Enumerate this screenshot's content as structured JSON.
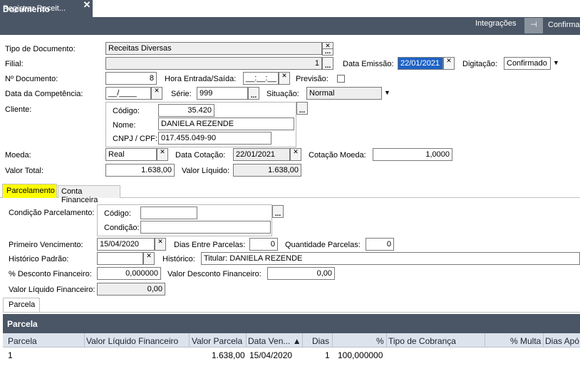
{
  "tab": {
    "title": "Registrar Receit...",
    "close": "✕"
  },
  "header": {
    "title": "Documento",
    "integracoes": "Integrações",
    "pin": "⊣",
    "confirmar": "Confirmar"
  },
  "form": {
    "tipo_documento": {
      "label": "Tipo de Documento:",
      "value": "Receitas Diversas"
    },
    "filial": {
      "label": "Filial:",
      "value": "1"
    },
    "data_emissao": {
      "label": "Data Emissão:",
      "value": "22/01/2021"
    },
    "digitacao": {
      "label": "Digitação:",
      "value": "Confirmado"
    },
    "num_documento": {
      "label": "Nº Documento:",
      "value": "8"
    },
    "hora_entrada": {
      "label": "Hora Entrada/Saída:",
      "value": "__:__:__"
    },
    "previsao": {
      "label": "Previsão:"
    },
    "data_competencia": {
      "label": "Data da Competência:",
      "value": "__/____"
    },
    "serie": {
      "label": "Série:",
      "value": "999"
    },
    "situacao": {
      "label": "Situação:",
      "value": "Normal"
    },
    "cliente": {
      "label": "Cliente:",
      "codigo_label": "Código:",
      "codigo": "35.420",
      "nome_label": "Nome:",
      "nome": "DANIELA REZENDE",
      "cnpj_label": "CNPJ / CPF:",
      "cnpj": "017.455.049-90"
    },
    "moeda": {
      "label": "Moeda:",
      "value": "Real"
    },
    "data_cotacao": {
      "label": "Data Cotação:",
      "value": "22/01/2021"
    },
    "cotacao_moeda": {
      "label": "Cotação Moeda:",
      "value": "1,0000"
    },
    "valor_total": {
      "label": "Valor Total:",
      "value": "1.638,00"
    },
    "valor_liquido": {
      "label": "Valor Líquido:",
      "value": "1.638,00"
    }
  },
  "tabs": {
    "parcelamento": "Parcelamento",
    "conta_financeira": "Conta Financeira"
  },
  "parcelamento": {
    "condicao": {
      "label": "Condição Parcelamento:",
      "codigo_label": "Código:",
      "codigo": "",
      "condicao_label": "Condição:",
      "condicao": ""
    },
    "primeiro_vencimento": {
      "label": "Primeiro Vencimento:",
      "value": "15/04/2020"
    },
    "dias_entre": {
      "label": "Dias Entre Parcelas:",
      "value": "0"
    },
    "qtd_parcelas": {
      "label": "Quantidade Parcelas:",
      "value": "0"
    },
    "historico_padrao": {
      "label": "Histórico Padrão:",
      "value": ""
    },
    "historico": {
      "label": "Histórico:",
      "value": "Titular: DANIELA REZENDE"
    },
    "desc_financeiro": {
      "label": "% Desconto Financeiro:",
      "value": "0,000000"
    },
    "valor_desc_financeiro": {
      "label": "Valor Desconto Financeiro:",
      "value": "0,00"
    },
    "valor_liq_financeiro": {
      "label": "Valor Líquido Financeiro:",
      "value": "0,00"
    }
  },
  "subtab": {
    "parcela": "Parcela"
  },
  "grid": {
    "title": "Parcela",
    "columns": [
      "Parcela",
      "Valor Líquido Financeiro",
      "Valor Parcela",
      "Data Ven... ▲",
      "Dias",
      "%",
      "Tipo de Cobrança",
      "% Multa",
      "Dias Apó"
    ],
    "rows": [
      {
        "parcela": "1",
        "valor_liq": "",
        "valor_parcela": "1.638,00",
        "data_ven": "15/04/2020",
        "dias": "1",
        "pct": "100,000000",
        "tipo": "",
        "multa": "",
        "dias_apos": ""
      }
    ]
  }
}
